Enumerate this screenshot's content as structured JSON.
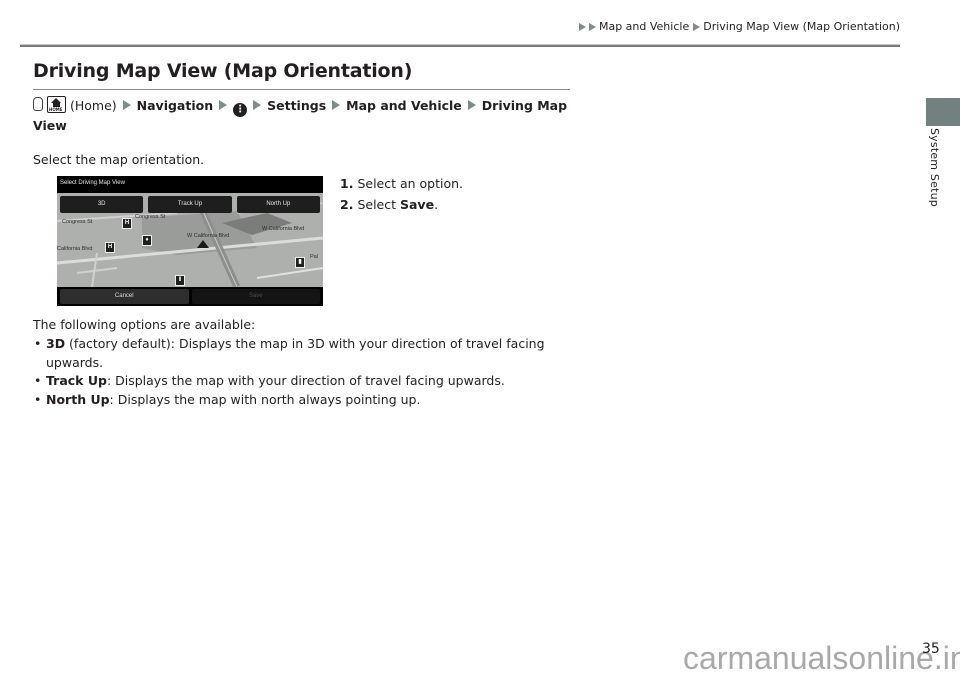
{
  "header": {
    "breadcrumb": [
      "Map and Vehicle",
      "Driving Map View (Map Orientation)"
    ]
  },
  "side_tab": {
    "label": "System Setup",
    "color": "#738080"
  },
  "page_title": "Driving Map View (Map Orientation)",
  "path": {
    "home_label": "(Home)",
    "home_icon_text": "HOME",
    "steps": [
      "Navigation",
      "Settings",
      "Map and Vehicle",
      "Driving Map View"
    ],
    "menu_icon_glyph": "⋮"
  },
  "intro": "Select the map orientation.",
  "screen": {
    "title": "Select Driving Map View",
    "options": [
      "3D",
      "Track Up",
      "North Up"
    ],
    "cancel_label": "Cancel",
    "save_label": "Save",
    "map_labels": [
      "Congress St",
      "Congress St",
      "W California Blvd",
      "W California Blvd",
      "California Blvd",
      "Pal"
    ]
  },
  "steps": [
    {
      "num": "1.",
      "text": "Select an option."
    },
    {
      "num": "2.",
      "text_before": "Select ",
      "bold": "Save",
      "text_after": "."
    }
  ],
  "options_intro": "The following options are available:",
  "options": [
    {
      "term": "3D",
      "desc": " (factory default): Displays the map in 3D with your direction of travel facing upwards."
    },
    {
      "term": "Track Up",
      "desc": ": Displays the map with your direction of travel facing upwards."
    },
    {
      "term": "North Up",
      "desc": ": Displays the map with north always pointing up."
    }
  ],
  "page_number": "35",
  "watermark": "carmanualsonline.info"
}
